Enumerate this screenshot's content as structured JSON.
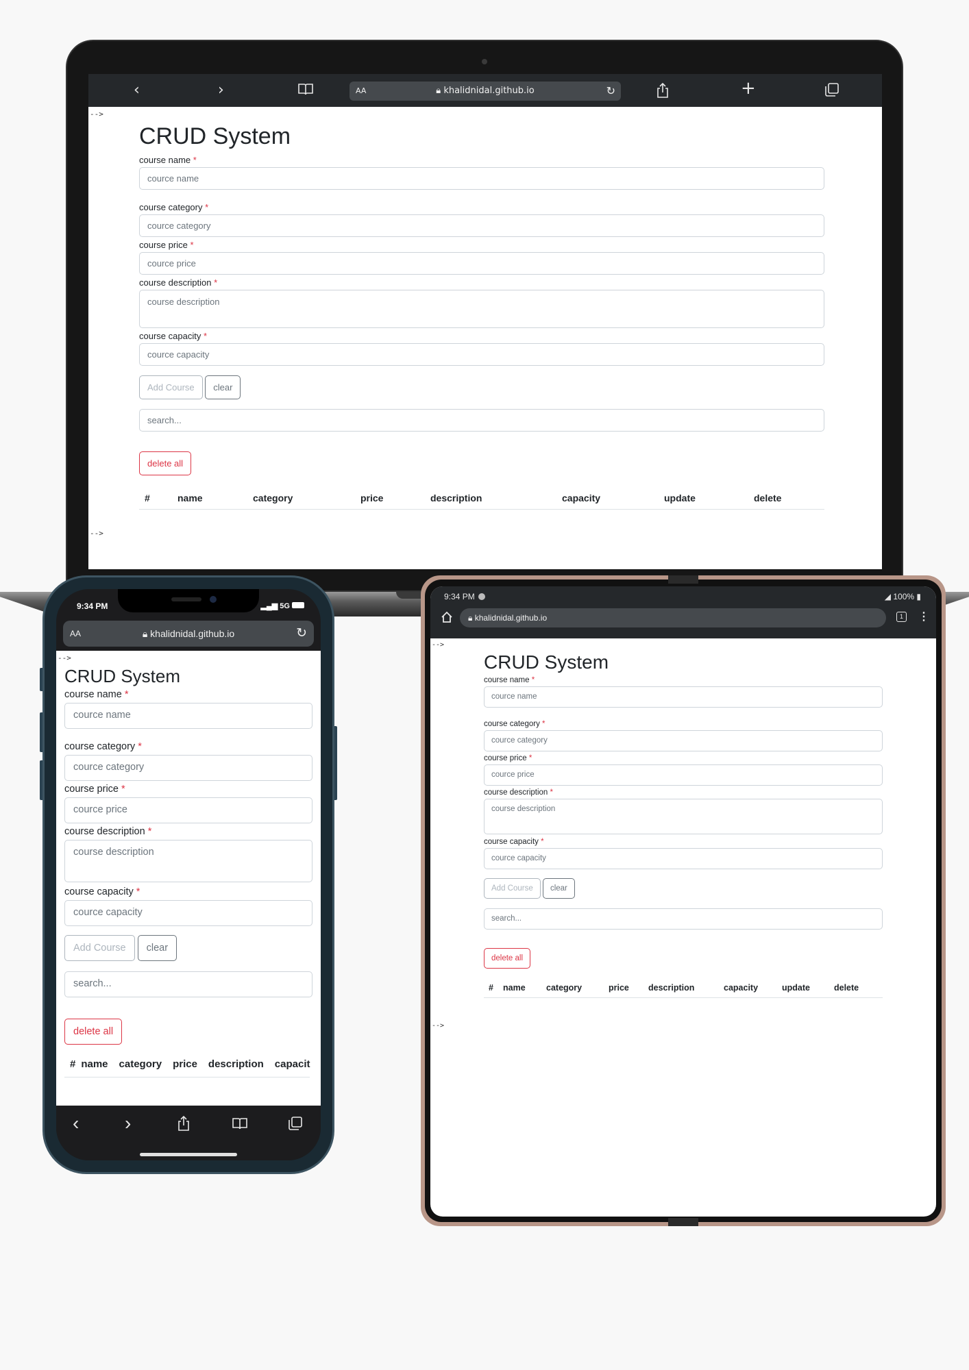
{
  "laptop": {
    "browser": {
      "text_size": "AA",
      "url": "khalidnidal.github.io",
      "back": "‹",
      "forward": "›",
      "bookmarks": "⊓",
      "reload": "↻",
      "share": "⇪",
      "new_tab": "+",
      "tabs": "⧉"
    },
    "comment_top": "-->",
    "comment_bottom": "-->"
  },
  "phone": {
    "status": {
      "time": "9:34 PM",
      "network": "5G"
    },
    "browser": {
      "text_size": "AA",
      "url": "khalidnidal.github.io"
    },
    "comment_top": "-->"
  },
  "tablet": {
    "status": {
      "time": "9:34 PM",
      "battery": "100%"
    },
    "browser": {
      "url": "khalidnidal.github.io",
      "tab_count": "1"
    },
    "comment_top": "-->",
    "comment_bottom": "-->"
  },
  "app": {
    "title": "CRUD System",
    "required_mark": "*",
    "fields": {
      "name": {
        "label": "course name",
        "placeholder": "cource name"
      },
      "category": {
        "label": "course category",
        "placeholder": "cource category"
      },
      "price": {
        "label": "course price",
        "placeholder": "cource price"
      },
      "description": {
        "label": "course description",
        "placeholder": "course description"
      },
      "capacity": {
        "label": "course capacity",
        "placeholder": "cource capacity"
      }
    },
    "add_button": "Add Course",
    "clear_button": "clear",
    "search_placeholder": "search...",
    "delete_all_button": "delete all",
    "table_headers": {
      "index": "#",
      "name": "name",
      "category": "category",
      "price": "price",
      "description": "description",
      "capacity": "capacity",
      "update": "update",
      "delete": "delete"
    },
    "phone_capacity_header": "capacit"
  },
  "colors": {
    "danger": "#dc3545",
    "muted": "#6c757d",
    "browser_bar": "#25282b"
  }
}
